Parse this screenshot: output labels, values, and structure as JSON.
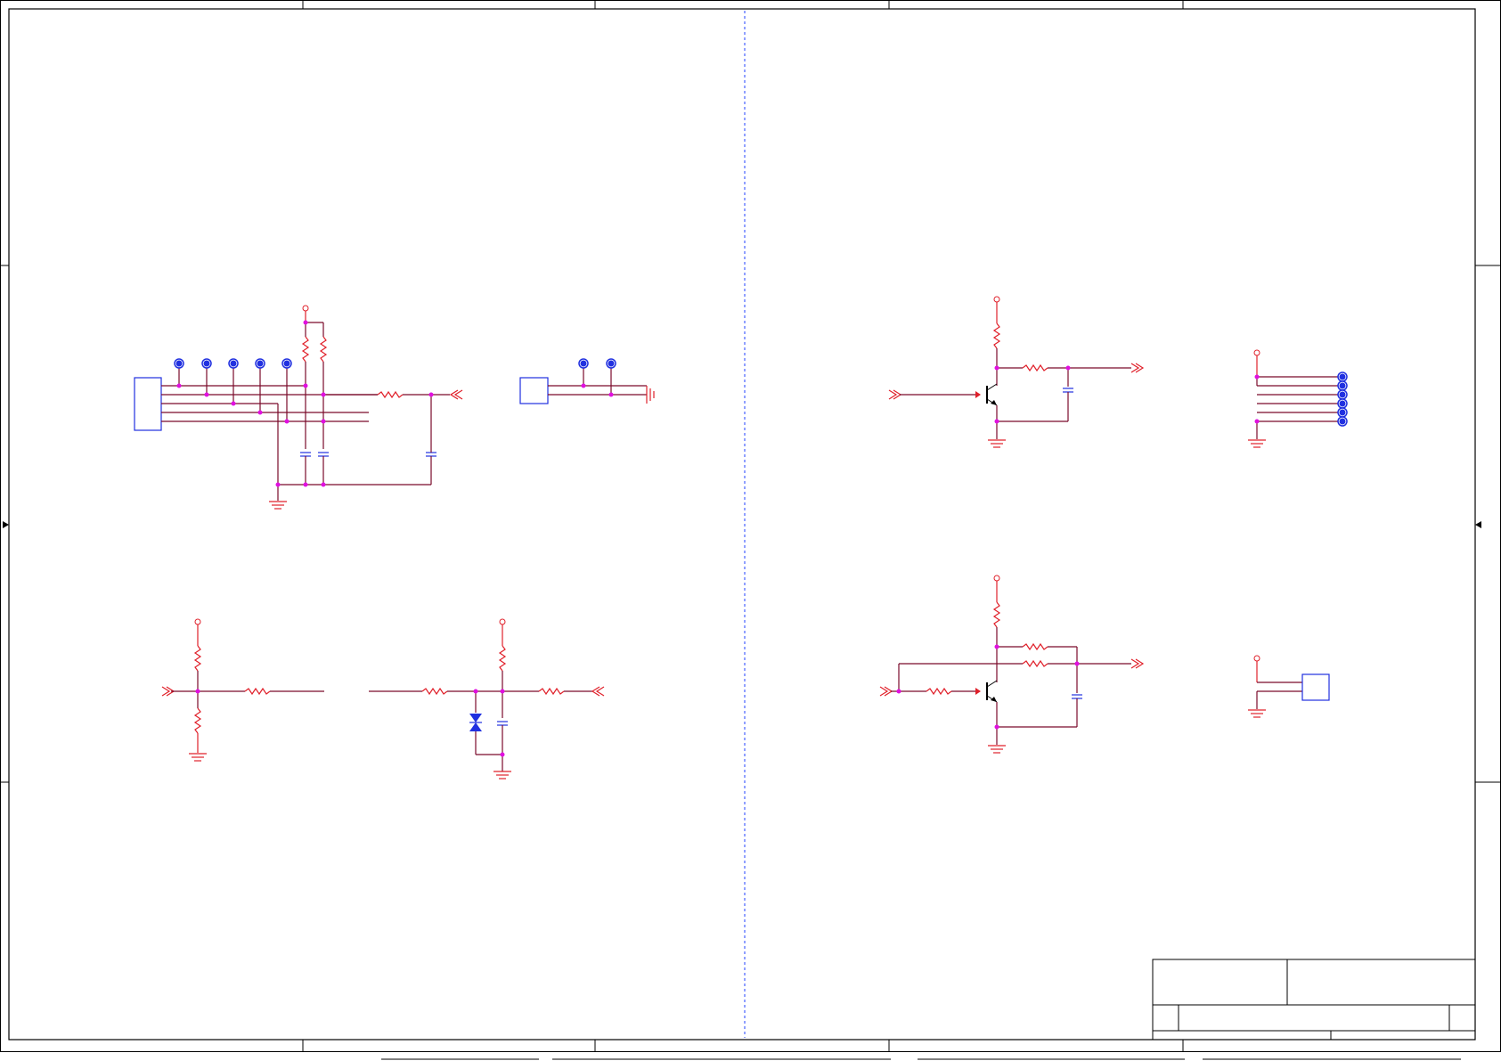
{
  "sheet": {
    "background": "#ffffff",
    "frame_color": "#000000",
    "wire_color": "#7a0a2a",
    "part_color": "#e0202a",
    "symbol_color": "#2030e0",
    "junction_color": "#e010e0"
  },
  "sections": [
    "connector-block",
    "jumper-block",
    "transistor-stage-upper",
    "header-pins",
    "divider-left",
    "divider-esd",
    "transistor-stage-lower",
    "single-connector"
  ],
  "title_block": {}
}
